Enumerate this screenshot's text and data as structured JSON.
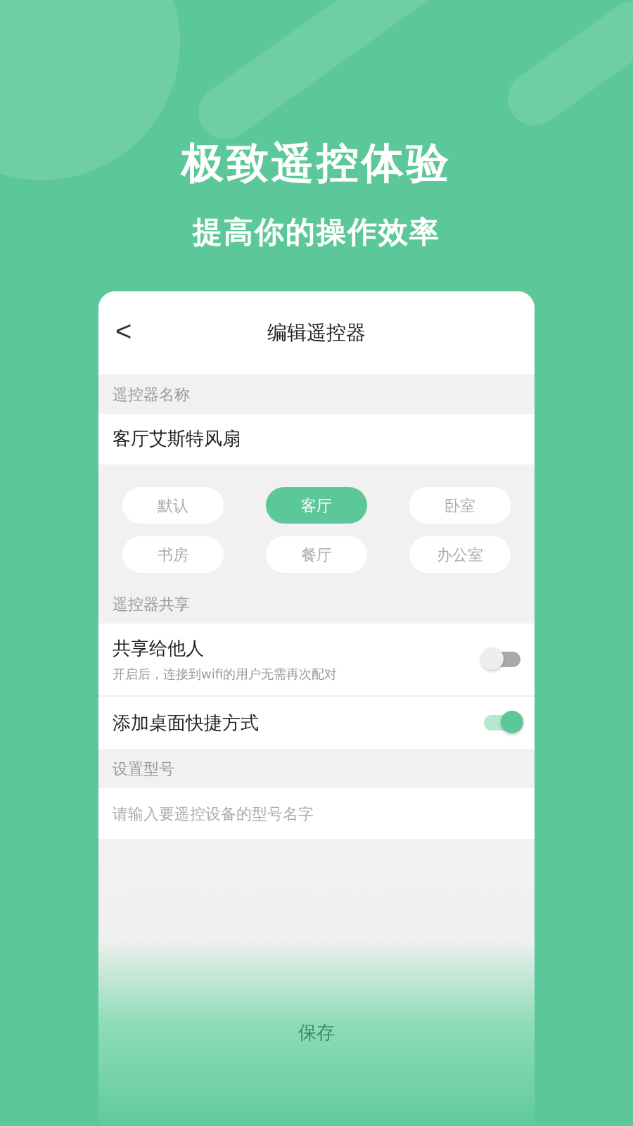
{
  "banner": {
    "title": "极致遥控体验",
    "subtitle": "提高你的操作效率"
  },
  "header": {
    "back": "<",
    "title": "编辑遥控器"
  },
  "name_section": {
    "label": "遥控器名称",
    "value": "客厅艾斯特风扇"
  },
  "rooms": [
    {
      "label": "默认",
      "selected": false
    },
    {
      "label": "客厅",
      "selected": true
    },
    {
      "label": "卧室",
      "selected": false
    },
    {
      "label": "书房",
      "selected": false
    },
    {
      "label": "餐厅",
      "selected": false
    },
    {
      "label": "办公室",
      "selected": false
    }
  ],
  "share_section": {
    "label": "遥控器共享",
    "items": [
      {
        "title": "共享给他人",
        "hint": "开启后，连接到wifi的用户无需再次配对",
        "on": false
      },
      {
        "title": "添加桌面快捷方式",
        "on": true
      }
    ]
  },
  "model_section": {
    "label": "设置型号",
    "placeholder": "请输入要遥控设备的型号名字"
  },
  "save": "保存"
}
